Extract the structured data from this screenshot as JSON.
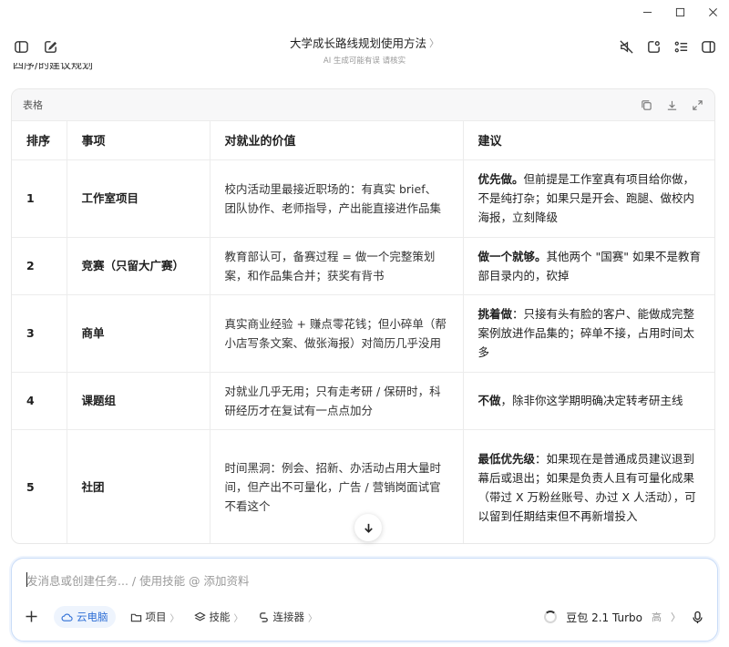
{
  "header": {
    "title": "大学成长路线规划使用方法",
    "title_chevron": "〉",
    "subtitle": "AI 生成可能有误 请核实"
  },
  "cutoff_text": "四序/的建议规划",
  "table_card": {
    "label": "表格",
    "columns": [
      "排序",
      "事项",
      "对就业的价值",
      "建议"
    ],
    "rows": [
      {
        "rank": "1",
        "item": "工作室项目",
        "value": "校内活动里最接近职场的：有真实 brief、团队协作、老师指导，产出能直接进作品集",
        "suggest_bold": "优先做。",
        "suggest_rest": "但前提是工作室真有项目给你做，不是纯打杂；如果只是开会、跑腿、做校内海报，立刻降级"
      },
      {
        "rank": "2",
        "item": "竞赛（只留大广赛）",
        "value": "教育部认可，备赛过程 = 做一个完整策划案，和作品集合并；获奖有背书",
        "suggest_bold": "做一个就够。",
        "suggest_rest": "其他两个 \"国赛\" 如果不是教育部目录内的，砍掉"
      },
      {
        "rank": "3",
        "item": "商单",
        "value": "真实商业经验 + 赚点零花钱；但小碎单（帮小店写条文案、做张海报）对简历几乎没用",
        "suggest_bold": "挑着做",
        "suggest_rest": "：只接有头有脸的客户、能做成完整案例放进作品集的；碎单不接，占用时间太多"
      },
      {
        "rank": "4",
        "item": "课题组",
        "value": "对就业几乎无用；只有走考研 / 保研时，科研经历才在复试有一点点加分",
        "suggest_bold": "不做",
        "suggest_rest": "，除非你这学期明确决定转考研主线"
      },
      {
        "rank": "5",
        "item": "社团",
        "value": "时间黑洞：例会、招新、办活动占用大量时间，但产出不可量化，广告 / 营销岗面试官不看这个",
        "suggest_bold": "最低优先级",
        "suggest_rest": "：如果现在是普通成员建议退到幕后或退出；如果是负责人且有可量化成果（带过 X 万粉丝账号、办过 X 人活动），可以留到任期结束但不再新增投入"
      }
    ]
  },
  "composer": {
    "placeholder": "发消息或创建任务... / 使用技能 @ 添加资料",
    "chips": {
      "cloud": "云电脑",
      "project": "项目",
      "skills": "技能",
      "connector": "连接器"
    },
    "chip_chevron": "〉",
    "model_name": "豆包 2.1 Turbo",
    "model_tier": "高",
    "model_chevron": "〉"
  },
  "colors": {
    "accent": "#2f6fd6",
    "composer_border": "#c9dcf7",
    "card_header_bg": "#f7f7f8"
  }
}
